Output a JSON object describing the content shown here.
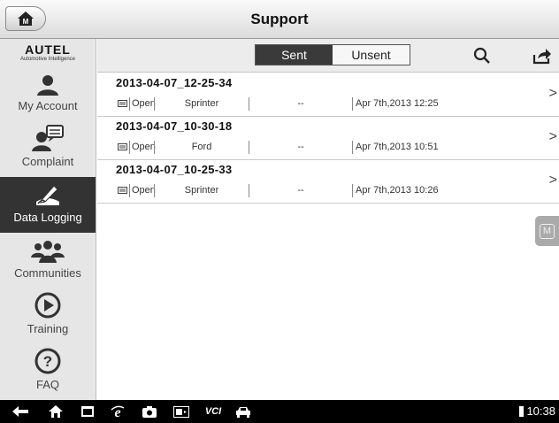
{
  "header": {
    "title": "Support"
  },
  "sidebar": {
    "brand": "AUTEL",
    "tagline": "Automotive Intelligence",
    "items": [
      {
        "label": "My Account",
        "icon": "person-icon"
      },
      {
        "label": "Complaint",
        "icon": "complaint-icon"
      },
      {
        "label": "Data Logging",
        "icon": "data-logging-icon",
        "active": true
      },
      {
        "label": "Communities",
        "icon": "people-icon"
      },
      {
        "label": "Training",
        "icon": "play-icon"
      },
      {
        "label": "FAQ",
        "icon": "question-icon"
      }
    ]
  },
  "toolbar": {
    "tab_sent": "Sent",
    "tab_unsent": "Unsent",
    "active_tab": "Sent"
  },
  "logs": [
    {
      "name": "2013-04-07_12-25-34",
      "status": "Open",
      "vehicle": "Sprinter",
      "extra": "--",
      "date": "Apr 7th,2013 12:25"
    },
    {
      "name": "2013-04-07_10-30-18",
      "status": "Open",
      "vehicle": "Ford",
      "extra": "--",
      "date": "Apr 7th,2013 10:51"
    },
    {
      "name": "2013-04-07_10-25-33",
      "status": "Open",
      "vehicle": "Sprinter",
      "extra": "--",
      "date": "Apr 7th,2013 10:26"
    }
  ],
  "floating": {
    "m_label": "M"
  },
  "statusbar": {
    "vci_label": "VCI",
    "time": "10:38"
  }
}
